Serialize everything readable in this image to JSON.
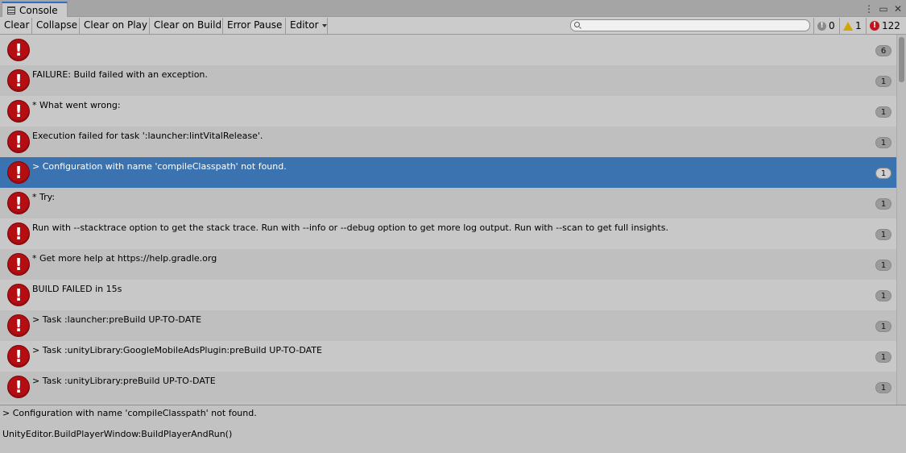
{
  "window": {
    "tab_label": "Console",
    "tab_icon": "console-list-icon",
    "controls": [
      "kebab-menu-icon",
      "maximize-icon",
      "close-icon"
    ]
  },
  "toolbar": {
    "clear": "Clear",
    "collapse": "Collapse",
    "clear_on_play": "Clear on Play",
    "clear_on_build": "Clear on Build",
    "error_pause": "Error Pause",
    "editor": "Editor",
    "search_value": "",
    "info_count": "0",
    "warning_count": "1",
    "error_count": "122"
  },
  "colors": {
    "selection": "#3b72b0",
    "error_red": "#b40d12",
    "warning_yellow": "#d6a400"
  },
  "log": [
    {
      "message": "",
      "count": "6",
      "type": "error"
    },
    {
      "message": "FAILURE: Build failed with an exception.",
      "count": "1",
      "type": "error"
    },
    {
      "message": "* What went wrong:",
      "count": "1",
      "type": "error"
    },
    {
      "message": "Execution failed for task ':launcher:lintVitalRelease'.",
      "count": "1",
      "type": "error"
    },
    {
      "message": "> Configuration with name 'compileClasspath' not found.",
      "count": "1",
      "type": "error",
      "selected": true
    },
    {
      "message": "* Try:",
      "count": "1",
      "type": "error"
    },
    {
      "message": "Run with --stacktrace option to get the stack trace. Run with --info or --debug option to get more log output. Run with --scan to get full insights.",
      "count": "1",
      "type": "error"
    },
    {
      "message": "* Get more help at https://help.gradle.org",
      "count": "1",
      "type": "error"
    },
    {
      "message": "BUILD FAILED in 15s",
      "count": "1",
      "type": "error"
    },
    {
      "message": "> Task :launcher:preBuild UP-TO-DATE",
      "count": "1",
      "type": "error"
    },
    {
      "message": "> Task :unityLibrary:GoogleMobileAdsPlugin:preBuild UP-TO-DATE",
      "count": "1",
      "type": "error"
    },
    {
      "message": "> Task :unityLibrary:preBuild UP-TO-DATE",
      "count": "1",
      "type": "error"
    }
  ],
  "detail": {
    "line1": "> Configuration with name 'compileClasspath' not found.",
    "line2": "UnityEditor.BuildPlayerWindow:BuildPlayerAndRun()"
  }
}
